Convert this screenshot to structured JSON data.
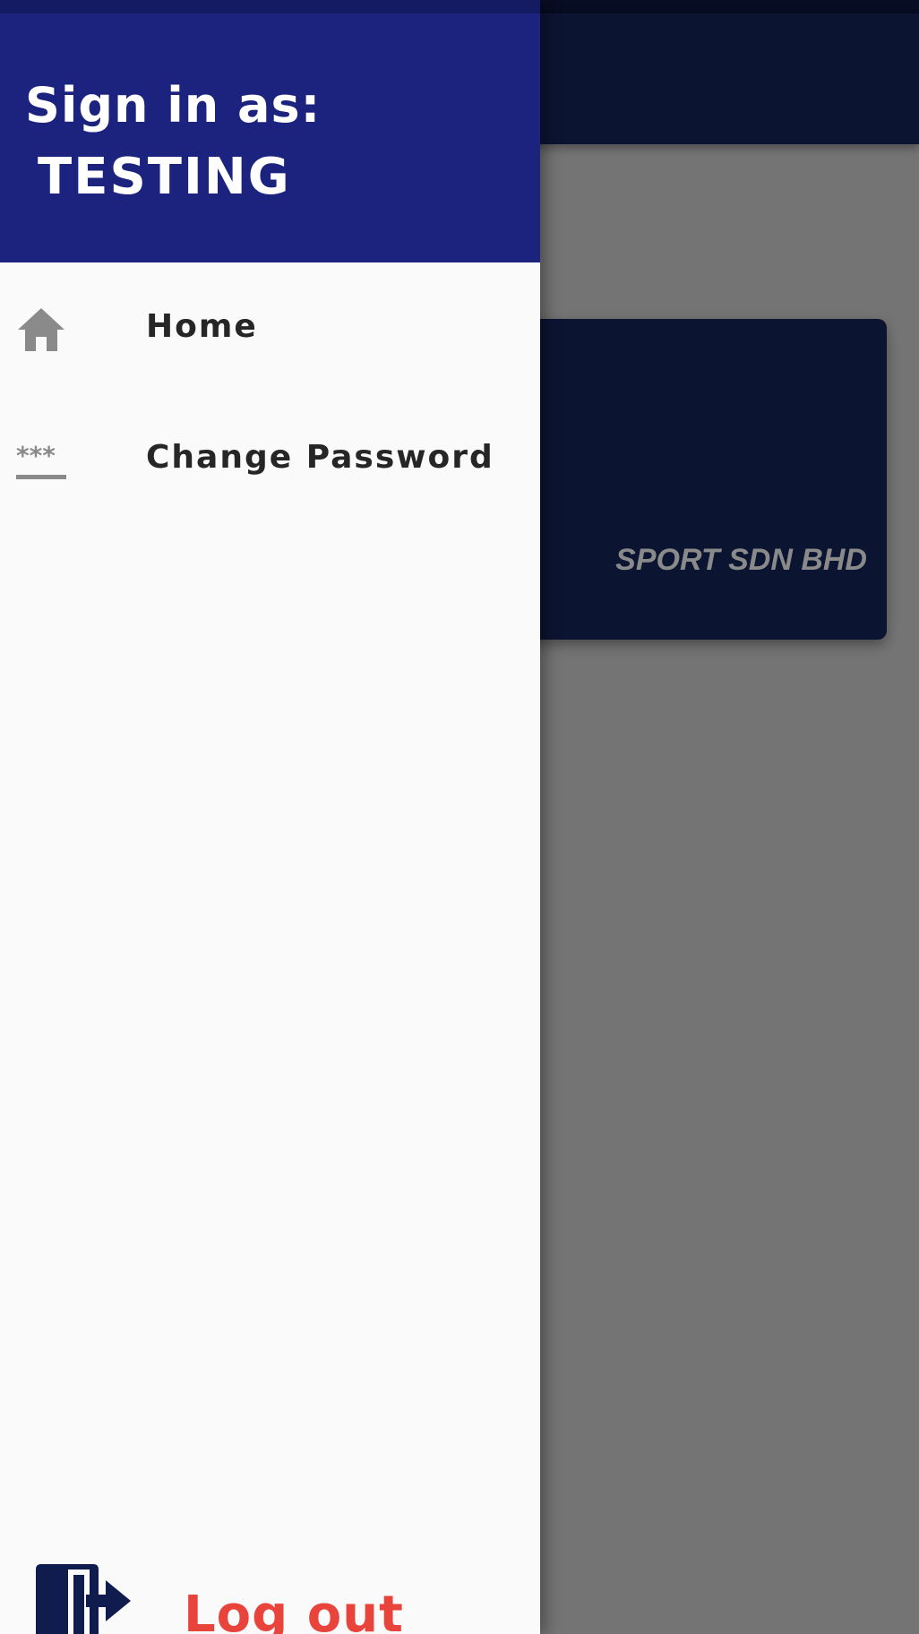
{
  "drawer": {
    "header": {
      "signin_label": "Sign in as:",
      "username": "TESTING",
      "background_color": "#1b237e"
    },
    "menu_items": [
      {
        "label": "Home",
        "icon": "home-icon"
      },
      {
        "label": "Change Password",
        "icon": "password-icon"
      }
    ],
    "logout": {
      "label": "Log out",
      "icon": "logout-icon",
      "color": "#e8443c"
    }
  },
  "background_app": {
    "card": {
      "company_text": "SPORT SDN BHD"
    }
  },
  "colors": {
    "primary_dark": "#0b1431",
    "scrim": "#747474"
  }
}
